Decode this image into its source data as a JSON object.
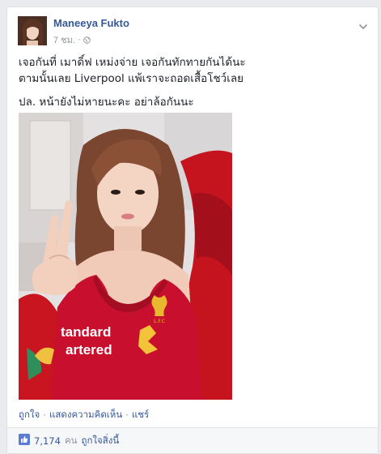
{
  "post": {
    "author": "Maneeya Fukto",
    "time": "7 ชม.",
    "meta_sep": "·",
    "text_line1": "เจอกันที่ เมาดิ์ฟ เหม่งจ่าย เจอกันทักทายกันได้นะ",
    "text_line2": "ตามนั้นเลย Liverpool แพ้เราจะถอดเสื้อโชว์เลย",
    "text_line3": "ปล. หน้ายังไม่หายนะคะ อย่าล้อกันนะ",
    "shirt_text1": "tandard",
    "shirt_text2": "artered",
    "crest_text": "L.F.C",
    "privacy_icon": "globe-icon",
    "menu_icon": "chevron-down-icon"
  },
  "actions": {
    "like": "ถูกใจ",
    "sep": "·",
    "comment": "แสดงความคิดเห็น",
    "share": "แชร์"
  },
  "likes": {
    "icon": "thumbs-up-icon",
    "count": "7,174",
    "unit": "คน",
    "label": "ถูกใจสิ่งนี้"
  },
  "colors": {
    "link": "#365899",
    "text": "#1d2129",
    "muted": "#90949c",
    "shirt_red": "#c8102e"
  }
}
